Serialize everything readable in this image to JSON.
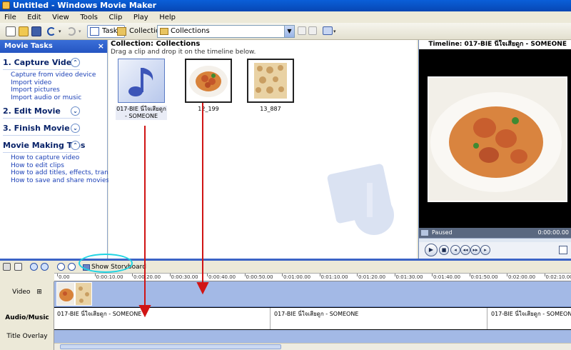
{
  "window": {
    "title": "Untitled - Windows Movie Maker"
  },
  "menu": [
    "File",
    "Edit",
    "View",
    "Tools",
    "Clip",
    "Play",
    "Help"
  ],
  "toolbar": {
    "tasks_label": "Tasks",
    "collections_label": "Collections",
    "collection_combo": "Collections"
  },
  "tasks_pane": {
    "header": "Movie Tasks",
    "close": "×",
    "sections": [
      {
        "title": "1. Capture Video",
        "chevron": "⌃",
        "links": [
          "Capture from video device",
          "Import video",
          "Import pictures",
          "Import audio or music"
        ]
      },
      {
        "title": "2. Edit Movie",
        "chevron": "⌄",
        "links": []
      },
      {
        "title": "3. Finish Movie",
        "chevron": "⌄",
        "links": []
      },
      {
        "title": "Movie Making Tips",
        "chevron": "⌃",
        "links": [
          "How to capture video",
          "How to edit clips",
          "How to add titles, effects, transitions",
          "How to save and share movies"
        ]
      }
    ]
  },
  "collection": {
    "title": "Collection: Collections",
    "subtitle": "Drag a clip and drop it on the timeline below.",
    "clips": [
      {
        "caption": "017-BIE นี่ใจเสียดูก - SOMEONE",
        "kind": "audio-icon"
      },
      {
        "caption": "12_199",
        "kind": "pasta-photo"
      },
      {
        "caption": "13_887",
        "kind": "bread-photo"
      }
    ]
  },
  "monitor": {
    "title": "Timeline: 017-BIE นี่ใจเสียดูก - SOMEONE",
    "status": "Paused",
    "time": "0:00:00.00",
    "controls": [
      "play",
      "stop",
      "previous-frame",
      "rewind",
      "fast-forward",
      "next-frame",
      "fullscreen"
    ]
  },
  "timeline": {
    "show_storyboard": "Show Storyboard",
    "ruler": [
      "0.00",
      "0:00:10.00",
      "0:00:20.00",
      "0:00:30.00",
      "0:00:40.00",
      "0:00:50.00",
      "0:01:00.00",
      "0:01:10.00",
      "0:01:20.00",
      "0:01:30.00",
      "0:01:40.00",
      "0:01:50.00",
      "0:02:00.00",
      "0:02:10.00"
    ],
    "tracks": {
      "video": "Video",
      "video_expand": "⊞",
      "audio": "Audio/Music",
      "overlay": "Title Overlay"
    },
    "audio_clips": [
      "017-BIE นี่ใจเสียดูก - SOMEONE",
      "017-BIE นี่ใจเสียดูก - SOMEONE",
      "017-BIE นี่ใจเสียดูก - SOMEONE"
    ]
  },
  "colors": {
    "accent": "#3b63c6",
    "annotation_arrow": "#d01414",
    "highlight": "#1fd4e3"
  }
}
